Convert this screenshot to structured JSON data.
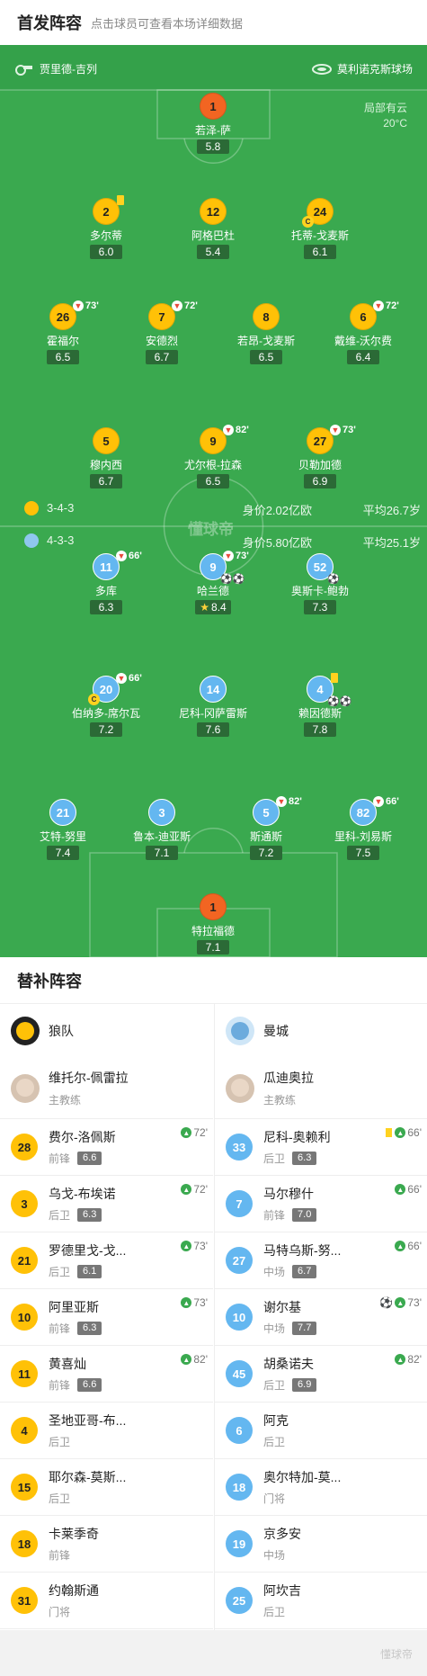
{
  "header": {
    "title": "首发阵容",
    "subtitle": "点击球员可查看本场详细数据"
  },
  "venue": {
    "referee": "贾里德-吉列",
    "stadium": "莫利诺克斯球场"
  },
  "weather": {
    "condition": "局部有云",
    "temp": "20°C"
  },
  "teams": {
    "home": {
      "name": "狼队",
      "formation": "3-4-3",
      "value": "身价2.02亿欧",
      "age": "平均26.7岁",
      "color": "#ffc107"
    },
    "away": {
      "name": "曼城",
      "formation": "4-3-3",
      "value": "身价5.80亿欧",
      "age": "平均25.1岁",
      "color": "#64b7f0"
    }
  },
  "watermark": "懂球帝",
  "home_lineup": [
    {
      "no": "1",
      "name": "若泽-萨",
      "rating": "5.8",
      "kit": "r"
    },
    {
      "no": "2",
      "name": "多尔蒂",
      "rating": "6.0",
      "kit": "o",
      "yellow": true
    },
    {
      "no": "12",
      "name": "阿格巴杜",
      "rating": "5.4",
      "kit": "o"
    },
    {
      "no": "24",
      "name": "托蒂-戈麦斯",
      "rating": "6.1",
      "kit": "o",
      "captain": true
    },
    {
      "no": "26",
      "name": "霍福尔",
      "rating": "6.5",
      "kit": "o",
      "subOff": "73'"
    },
    {
      "no": "7",
      "name": "安德烈",
      "rating": "6.7",
      "kit": "o",
      "subOff": "72'"
    },
    {
      "no": "8",
      "name": "若昂-戈麦斯",
      "rating": "6.5",
      "kit": "o"
    },
    {
      "no": "6",
      "name": "戴维-沃尔费",
      "rating": "6.4",
      "kit": "o",
      "subOff": "72'"
    },
    {
      "no": "5",
      "name": "穆内西",
      "rating": "6.7",
      "kit": "o"
    },
    {
      "no": "9",
      "name": "尤尔根-拉森",
      "rating": "6.5",
      "kit": "o",
      "subOff": "82'"
    },
    {
      "no": "27",
      "name": "贝勒加德",
      "rating": "6.9",
      "kit": "o",
      "subOff": "73'"
    }
  ],
  "away_lineup": [
    {
      "no": "11",
      "name": "多库",
      "rating": "6.3",
      "kit": "b",
      "subOff": "66'"
    },
    {
      "no": "9",
      "name": "哈兰德",
      "rating": "8.4",
      "kit": "b",
      "subOff": "73'",
      "star": true,
      "events": "⚽⚽"
    },
    {
      "no": "52",
      "name": "奥斯卡-鲍勃",
      "rating": "7.3",
      "kit": "b",
      "events": "⚽"
    },
    {
      "no": "20",
      "name": "伯纳多-席尔瓦",
      "rating": "7.2",
      "kit": "b",
      "subOff": "66'",
      "captain": true
    },
    {
      "no": "14",
      "name": "尼科-冈萨雷斯",
      "rating": "7.6",
      "kit": "b"
    },
    {
      "no": "4",
      "name": "赖因德斯",
      "rating": "7.8",
      "kit": "b",
      "yellow": true,
      "events": "⚽⚽"
    },
    {
      "no": "21",
      "name": "艾特-努里",
      "rating": "7.4",
      "kit": "b"
    },
    {
      "no": "3",
      "name": "鲁本-迪亚斯",
      "rating": "7.1",
      "kit": "b"
    },
    {
      "no": "5",
      "name": "斯通斯",
      "rating": "7.2",
      "kit": "b",
      "subOff": "82'"
    },
    {
      "no": "82",
      "name": "里科-刘易斯",
      "rating": "7.5",
      "kit": "b",
      "subOff": "66'"
    },
    {
      "no": "1",
      "name": "特拉福德",
      "rating": "7.1",
      "kit": "r"
    }
  ],
  "subs": {
    "title": "替补阵容",
    "home_coach": {
      "name": "维托尔-佩雷拉",
      "role": "主教练"
    },
    "away_coach": {
      "name": "瓜迪奥拉",
      "role": "主教练"
    },
    "home": [
      {
        "no": "28",
        "name": "费尔-洛佩斯",
        "pos": "前锋",
        "rating": "6.6",
        "in": "72'"
      },
      {
        "no": "3",
        "name": "乌戈-布埃诺",
        "pos": "后卫",
        "rating": "6.3",
        "in": "72'"
      },
      {
        "no": "21",
        "name": "罗德里戈-戈...",
        "pos": "后卫",
        "rating": "6.1",
        "in": "73'"
      },
      {
        "no": "10",
        "name": "阿里亚斯",
        "pos": "前锋",
        "rating": "6.3",
        "in": "73'"
      },
      {
        "no": "11",
        "name": "黄喜灿",
        "pos": "前锋",
        "rating": "6.6",
        "in": "82'"
      },
      {
        "no": "4",
        "name": "圣地亚哥-布...",
        "pos": "后卫"
      },
      {
        "no": "15",
        "name": "耶尔森-莫斯...",
        "pos": "后卫"
      },
      {
        "no": "18",
        "name": "卡莱季奇",
        "pos": "前锋"
      },
      {
        "no": "31",
        "name": "约翰斯通",
        "pos": "门将"
      }
    ],
    "away": [
      {
        "no": "33",
        "name": "尼科-奥赖利",
        "pos": "后卫",
        "rating": "6.3",
        "in": "66'",
        "yellow": true
      },
      {
        "no": "7",
        "name": "马尔穆什",
        "pos": "前锋",
        "rating": "7.0",
        "in": "66'"
      },
      {
        "no": "27",
        "name": "马特乌斯-努...",
        "pos": "中场",
        "rating": "6.7",
        "in": "66'"
      },
      {
        "no": "10",
        "name": "谢尔基",
        "pos": "中场",
        "rating": "7.7",
        "in": "73'",
        "goal": true
      },
      {
        "no": "45",
        "name": "胡桑诺夫",
        "pos": "后卫",
        "rating": "6.9",
        "in": "82'"
      },
      {
        "no": "6",
        "name": "阿克",
        "pos": "后卫"
      },
      {
        "no": "18",
        "name": "奥尔特加-莫...",
        "pos": "门将"
      },
      {
        "no": "19",
        "name": "京多安",
        "pos": "中场"
      },
      {
        "no": "25",
        "name": "阿坎吉",
        "pos": "后卫"
      }
    ]
  }
}
